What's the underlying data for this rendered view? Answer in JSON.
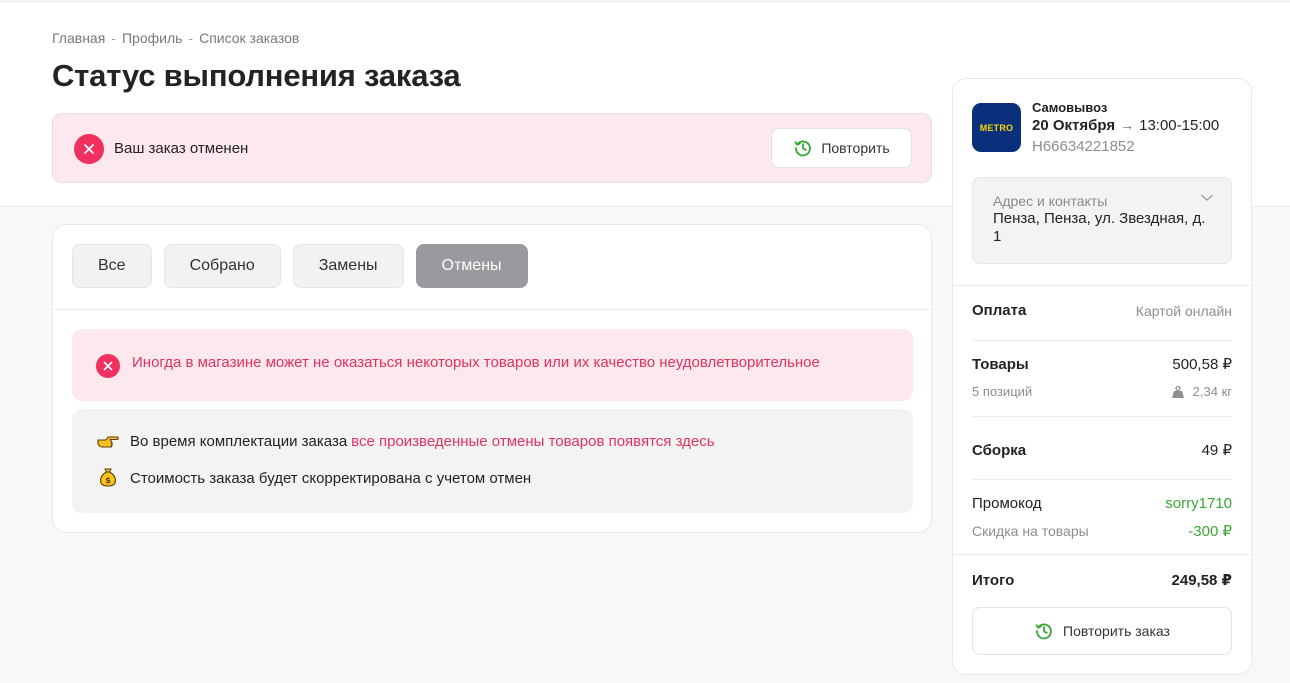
{
  "breadcrumb": {
    "items": [
      "Главная",
      "Профиль",
      "Список заказов"
    ],
    "separator": "-"
  },
  "page_title": "Статус выполнения заказа",
  "status_alert": {
    "text": "Ваш заказ отменен",
    "repeat_label": "Повторить"
  },
  "tabs": [
    {
      "label": "Все",
      "active": false
    },
    {
      "label": "Собрано",
      "active": false
    },
    {
      "label": "Замены",
      "active": false
    },
    {
      "label": "Отмены",
      "active": true
    }
  ],
  "warning_text": "Иногда в магазине может не оказаться некоторых товаров или их качество неудовлетворительное",
  "info": {
    "line1_prefix": "Во время комплектации заказа",
    "line1_highlight": "все произведенные отмены товаров появятся здесь",
    "line2": "Стоимость заказа будет скорректирована с учетом отмен"
  },
  "order": {
    "store_logo_text": "METRO",
    "delivery_type": "Самовывоз",
    "date": "20 Октября",
    "arrow": "→",
    "time_range": "13:00-15:00",
    "order_number": "H66634221852",
    "address_label": "Адрес и контакты",
    "address_value": "Пенза, Пенза, ул. Звездная, д. 1",
    "payment_label": "Оплата",
    "payment_value": "Картой онлайн",
    "goods_label": "Товары",
    "goods_value": "500,58 ₽",
    "positions": "5 позиций",
    "weight": "2,34 кг",
    "assembly_label": "Сборка",
    "assembly_value": "49 ₽",
    "promo_label": "Промокод",
    "promo_value": "sorry1710",
    "discount_label": "Скидка на товары",
    "discount_value": "-300 ₽",
    "total_label": "Итого",
    "total_value": "249,58 ₽",
    "repeat_order_label": "Повторить заказ"
  },
  "colors": {
    "accent_red": "#f0305f",
    "pink_text": "#e0335f",
    "green": "#3aa735",
    "active_tab": "#9a9a9e",
    "metro_blue": "#0a2f7b",
    "metro_yellow": "#ffd700"
  },
  "icons": [
    "close-icon",
    "history-icon",
    "pointing-hand-icon",
    "money-bag-icon",
    "chevron-down-icon",
    "weight-icon"
  ]
}
